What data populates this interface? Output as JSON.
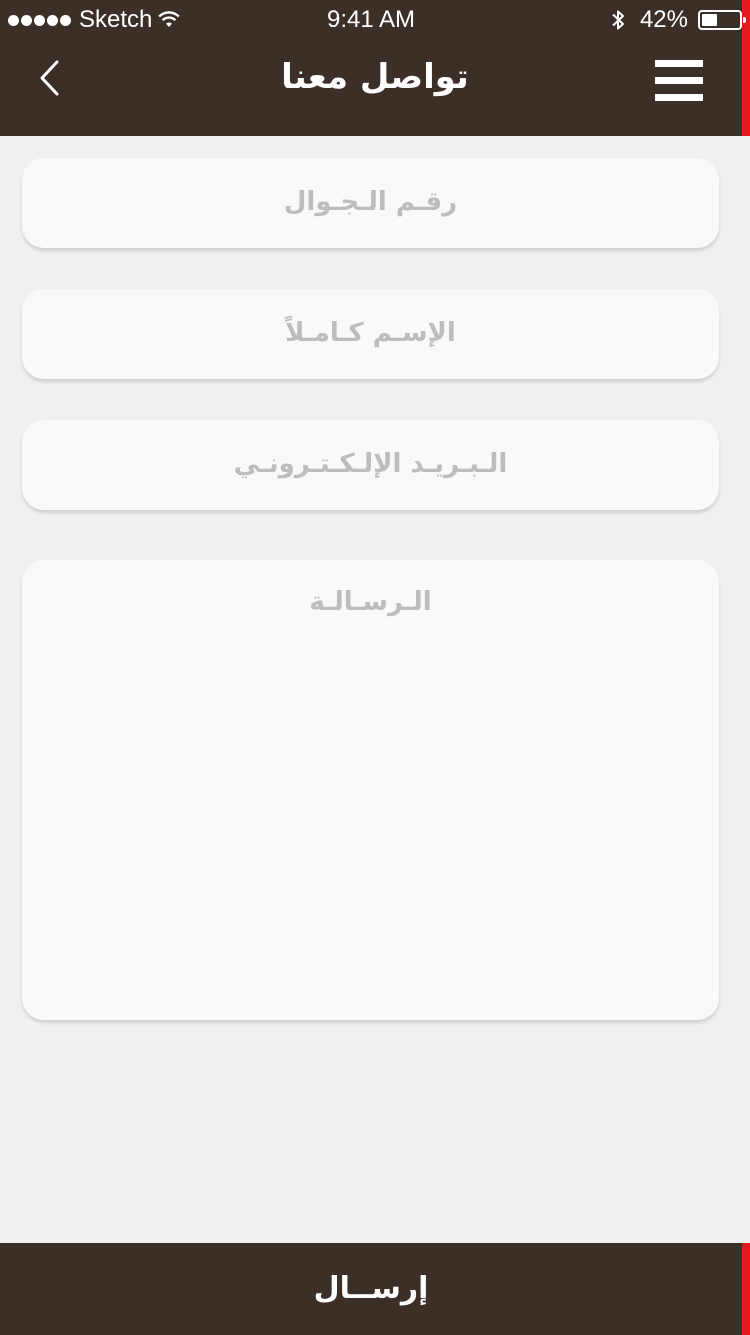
{
  "status_bar": {
    "carrier": "Sketch",
    "time": "9:41 AM",
    "battery_percent": "42%",
    "battery_level": 0.42,
    "signal_dots": 5,
    "icons": [
      "signal-dots-icon",
      "wifi-icon",
      "bluetooth-icon",
      "battery-icon"
    ]
  },
  "header": {
    "title": "تواصل معنا",
    "back_icon": "chevron-left-icon",
    "menu_icon": "hamburger-menu-icon",
    "background_color": "#3c2f28",
    "accent_color": "#e3191b"
  },
  "form": {
    "mobile_placeholder": "رقـم الـجـوال",
    "full_name_placeholder": "الإسـم كـامـلاً",
    "email_placeholder": "الـبـريـد الإلـكـتـرونـي",
    "message_placeholder": "الـرسـالـة"
  },
  "footer": {
    "send_label": "إرســال"
  }
}
